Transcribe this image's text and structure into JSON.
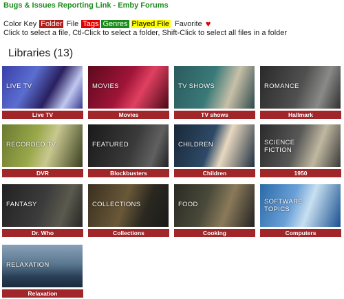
{
  "header": {
    "link_text": "Bugs & Issues Reporting Link - Emby Forums"
  },
  "color_key": {
    "label": "Color Key",
    "folder": "Folder",
    "file": "File",
    "tags": "Tags",
    "genres": "Genres",
    "played": "Played File",
    "favorite": "Favorite",
    "heart": "♥"
  },
  "instructions": "Click to select a file, Ctl-Click to select a folder, Shift-Click to select all files in a folder",
  "libraries": {
    "title": "Libraries (13)",
    "items": [
      {
        "thumb_text": "LIVE TV",
        "caption": "Live TV"
      },
      {
        "thumb_text": "MOVIES",
        "caption": "Movies"
      },
      {
        "thumb_text": "TV SHOWS",
        "caption": "TV shows"
      },
      {
        "thumb_text": "ROMANCE",
        "caption": "Hallmark"
      },
      {
        "thumb_text": "RECORDED TV",
        "caption": "DVR"
      },
      {
        "thumb_text": "FEATURED",
        "caption": "Blockbusters"
      },
      {
        "thumb_text": "CHILDREN",
        "caption": "Children"
      },
      {
        "thumb_text": "SCIENCE\nFICTION",
        "caption": "1950"
      },
      {
        "thumb_text": "FANTASY",
        "caption": "Dr. Who"
      },
      {
        "thumb_text": "COLLECTIONS",
        "caption": "Collections"
      },
      {
        "thumb_text": "FOOD",
        "caption": "Cooking"
      },
      {
        "thumb_text": "SOFTWARE\nTOPICS",
        "caption": "Computers"
      },
      {
        "thumb_text": "RELAXATION",
        "caption": "Relaxation"
      }
    ]
  }
}
